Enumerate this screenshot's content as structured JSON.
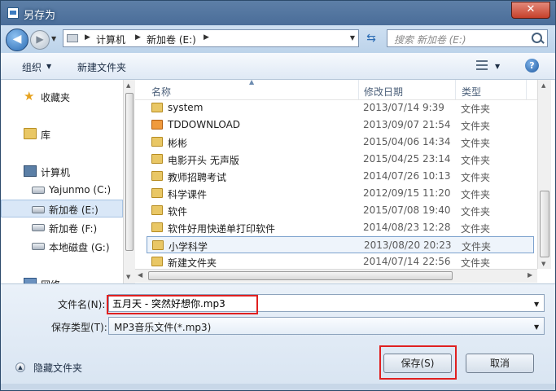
{
  "window": {
    "title": "另存为",
    "close_label": "✕"
  },
  "address": {
    "segments": [
      "计算机",
      "新加卷 (E:)"
    ],
    "search_placeholder": "搜索 新加卷 (E:)"
  },
  "toolbar": {
    "organize": "组织",
    "new_folder": "新建文件夹",
    "help": "?"
  },
  "nav": {
    "items": [
      {
        "label": "收藏夹",
        "icon": "star-icon"
      },
      {
        "label": "库",
        "icon": "library-icon"
      },
      {
        "label": "计算机",
        "icon": "computer-icon"
      },
      {
        "label": "Yajunmo (C:)",
        "icon": "drive-icon"
      },
      {
        "label": "新加卷 (E:)",
        "icon": "drive-icon",
        "selected": true
      },
      {
        "label": "新加卷 (F:)",
        "icon": "drive-icon"
      },
      {
        "label": "本地磁盘 (G:)",
        "icon": "drive-icon"
      },
      {
        "label": "网络",
        "icon": "network-icon"
      }
    ]
  },
  "files": {
    "columns": {
      "name": "名称",
      "date": "修改日期",
      "type": "类型"
    },
    "rows": [
      {
        "name": "system",
        "date": "2013/07/14 9:39",
        "type": "文件夹"
      },
      {
        "name": "TDDOWNLOAD",
        "date": "2013/09/07 21:54",
        "type": "文件夹"
      },
      {
        "name": "彬彬",
        "date": "2015/04/06 14:34",
        "type": "文件夹"
      },
      {
        "name": "电影开头  无声版",
        "date": "2015/04/25 23:14",
        "type": "文件夹"
      },
      {
        "name": "教师招聘考试",
        "date": "2014/07/26 10:13",
        "type": "文件夹"
      },
      {
        "name": "科学课件",
        "date": "2012/09/15 11:20",
        "type": "文件夹"
      },
      {
        "name": "软件",
        "date": "2015/07/08 19:40",
        "type": "文件夹"
      },
      {
        "name": "软件好用快递单打印软件",
        "date": "2014/08/23 12:28",
        "type": "文件夹"
      },
      {
        "name": "小学科学",
        "date": "2013/08/20 20:23",
        "type": "文件夹",
        "selected": true
      },
      {
        "name": "新建文件夹",
        "date": "2014/07/14 22:56",
        "type": "文件夹"
      }
    ]
  },
  "form": {
    "filename_label": "文件名(N):",
    "filename_value": "五月天 - 突然好想你.mp3",
    "type_label": "保存类型(T):",
    "type_value": "MP3音乐文件(*.mp3)",
    "hide_folders": "隐藏文件夹",
    "save": "保存(S)",
    "cancel": "取消"
  },
  "colors": {
    "highlight": "#e02020",
    "titlebar": "#4a6d99",
    "selection": "#d9e7f7"
  }
}
